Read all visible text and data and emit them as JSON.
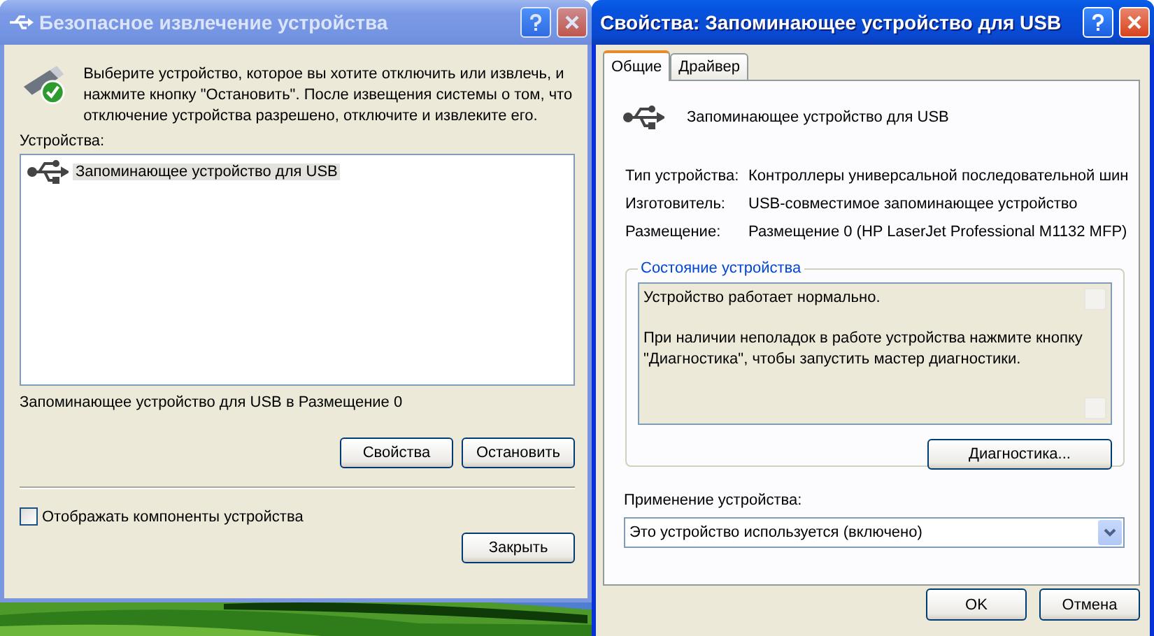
{
  "safe_removal": {
    "title": "Безопасное извлечение устройства",
    "active": false,
    "intro": "Выберите устройство, которое вы хотите отключить или извлечь, и нажмите кнопку \"Остановить\". После извещения системы о том, что отключение устройства разрешено, отключите и извлеките его.",
    "devices_label": "Устройства:",
    "devices": [
      {
        "label": "Запоминающее устройство для USB",
        "selected": true
      }
    ],
    "device_status": "Запоминающее устройство для USB в Размещение 0",
    "buttons": [
      "Свойства",
      "Остановить"
    ],
    "show_components": {
      "label": "Отображать компоненты устройства",
      "checked": false
    },
    "close_button": "Закрыть"
  },
  "properties": {
    "title": "Свойства: Запоминающее устройство для USB",
    "active": true,
    "tabs": [
      {
        "label": "Общие",
        "selected": true
      },
      {
        "label": "Драйвер",
        "selected": false
      }
    ],
    "device_name": "Запоминающее устройство для USB",
    "info": [
      {
        "label": "Тип устройства:",
        "value": "Контроллеры универсальной последовательной шин"
      },
      {
        "label": "Изготовитель:",
        "value": "USB-совместимое запоминающее устройство"
      },
      {
        "label": "Размещение:",
        "value": "Размещение 0 (HP LaserJet Professional M1132 MFP)"
      }
    ],
    "status_group": {
      "title": "Состояние устройства",
      "paragraphs": [
        "Устройство работает нормально.",
        "При наличии неполадок в работе устройства нажмите кнопку \"Диагностика\", чтобы запустить мастер диагностики."
      ],
      "button": "Диагностика..."
    },
    "usage": {
      "label": "Применение устройства:",
      "value": "Это устройство используется (включено)"
    },
    "buttons": [
      "OK",
      "Отмена"
    ]
  }
}
